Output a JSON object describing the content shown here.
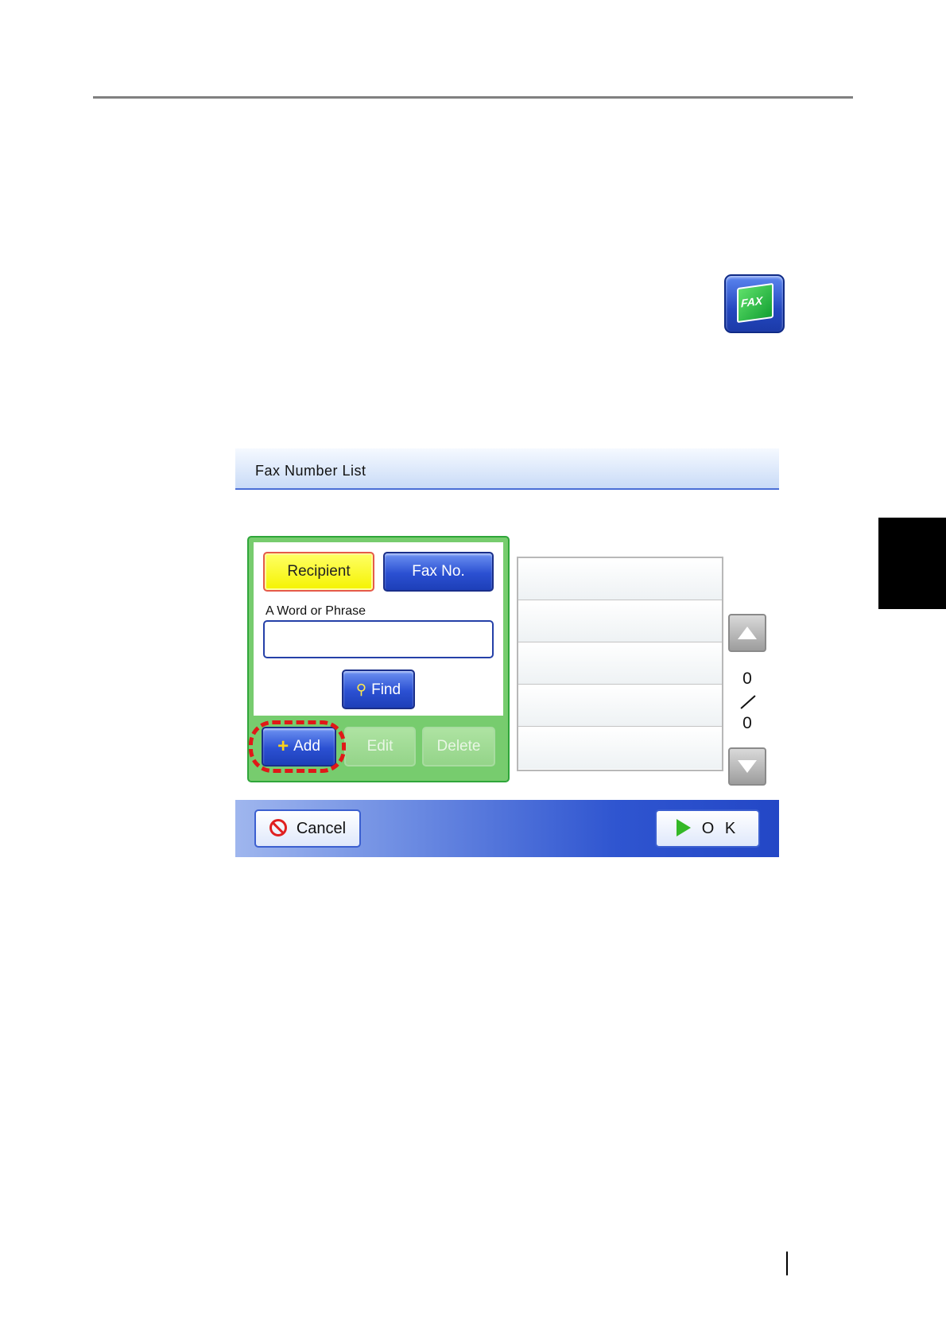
{
  "dialog": {
    "title": "Fax Number List"
  },
  "search": {
    "recipient_label": "Recipient",
    "faxno_label": "Fax No.",
    "word_label": "A Word or Phrase",
    "input_value": "",
    "find_label": "Find"
  },
  "actions": {
    "add_label": "Add",
    "edit_label": "Edit",
    "delete_label": "Delete"
  },
  "list": {
    "rows": [
      "",
      "",
      "",
      "",
      ""
    ]
  },
  "paging": {
    "current": "0",
    "total": "0"
  },
  "footer": {
    "cancel_label": "Cancel",
    "ok_label": "O K"
  },
  "app_icon": {
    "label": "FAX"
  },
  "icons": {
    "find": "search-icon",
    "add": "plus-icon",
    "cancel": "prohibited-icon",
    "ok": "play-arrow-icon"
  },
  "colors": {
    "selected_button": "#f5f300",
    "primary_button": "#2b50d2",
    "panel_green": "#77cc6e",
    "highlight": "#e01818"
  }
}
